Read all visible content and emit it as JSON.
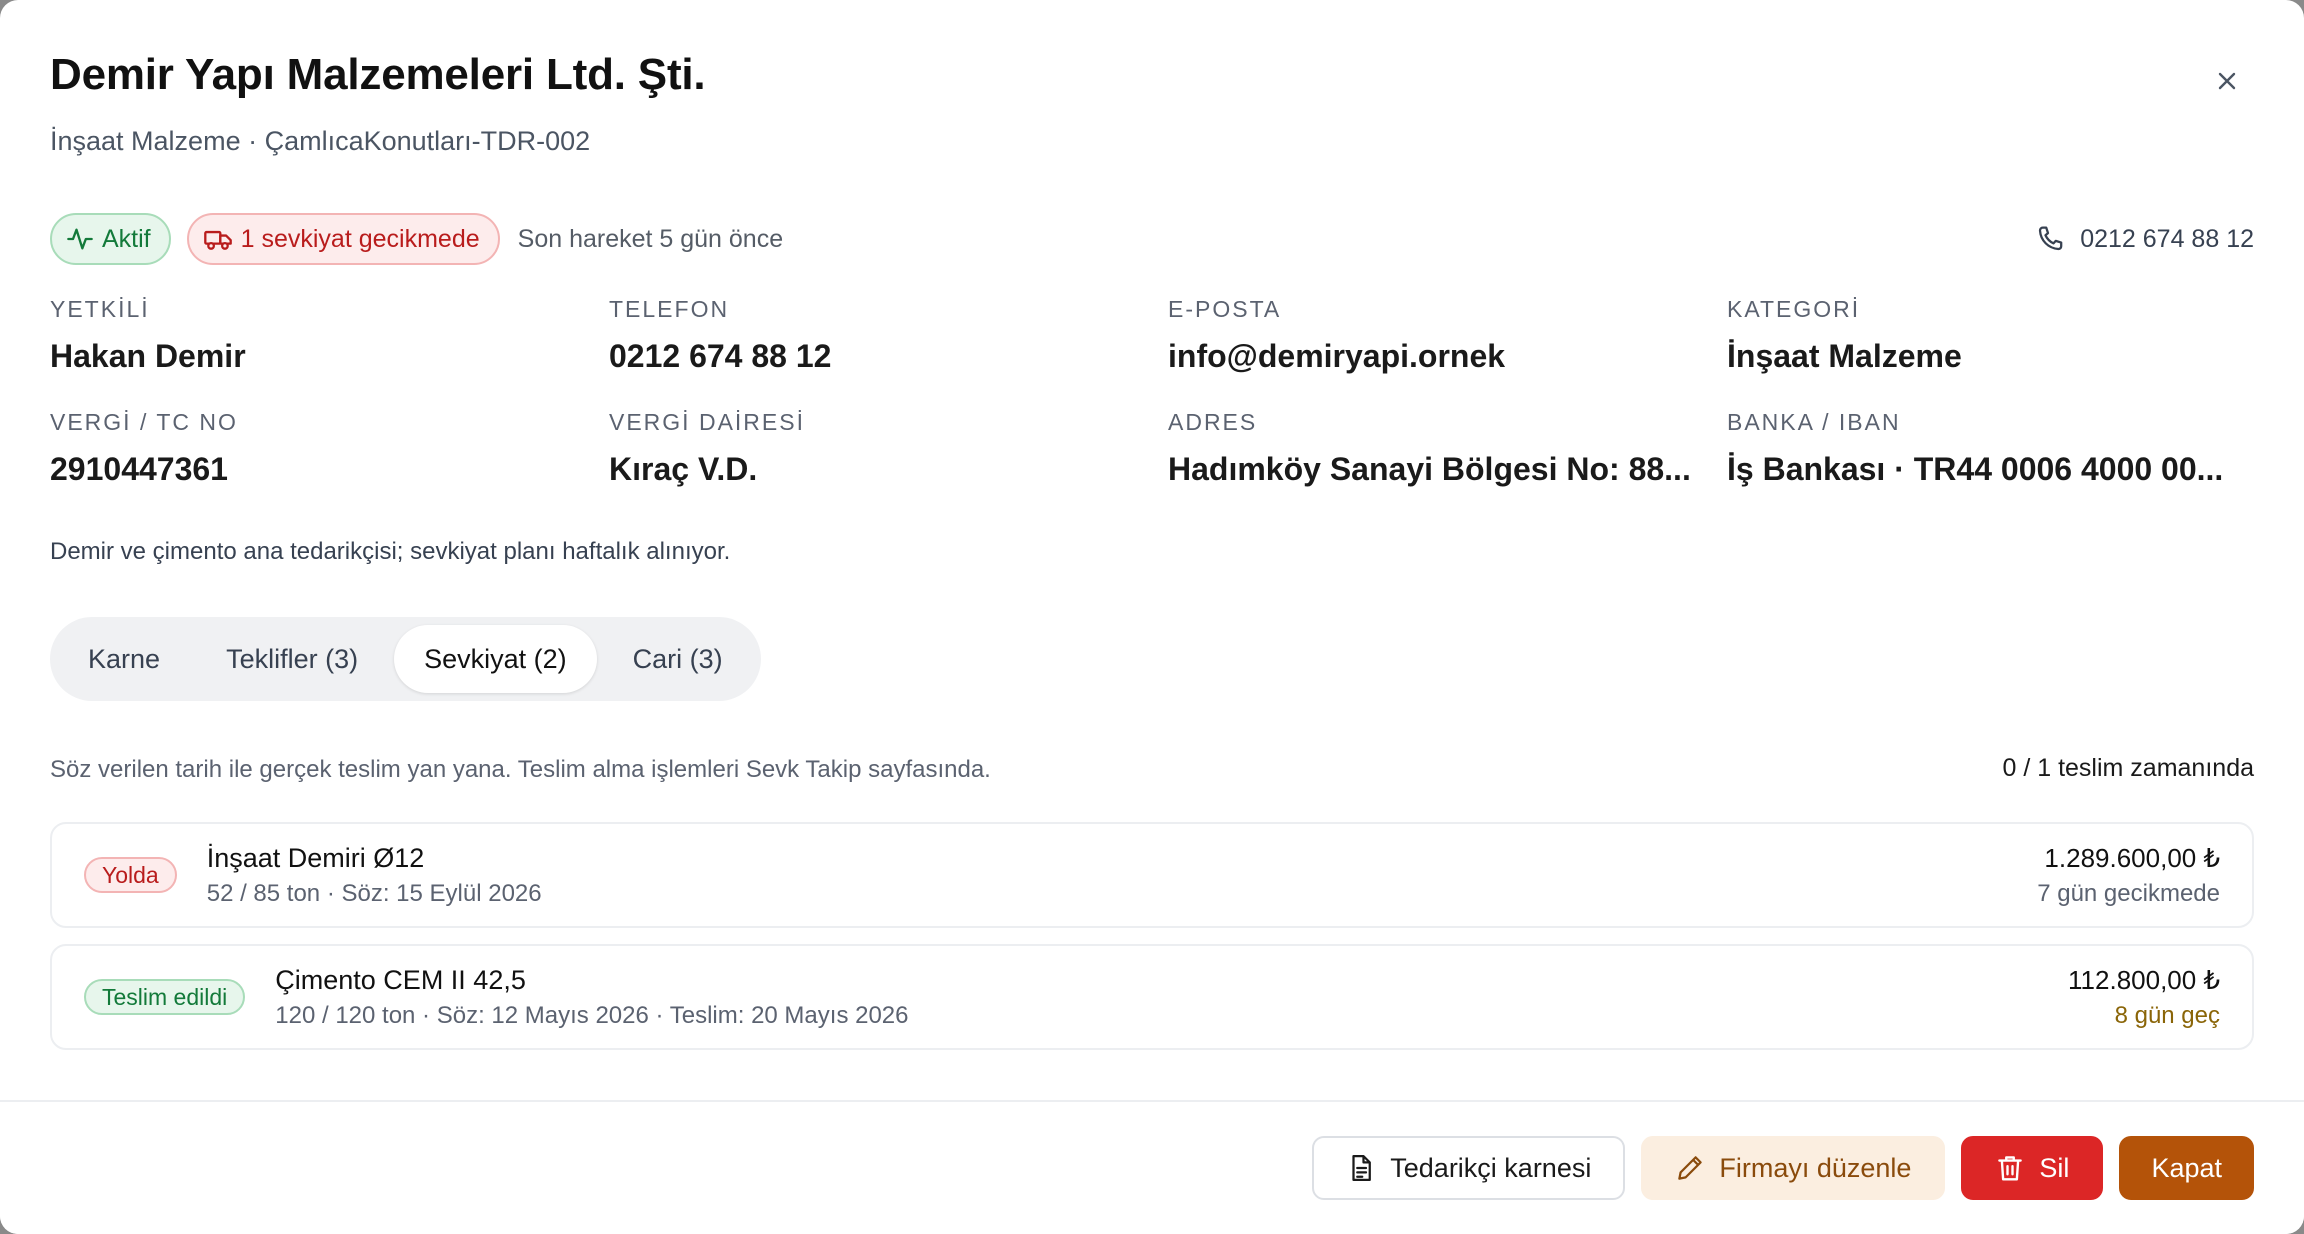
{
  "supplier": {
    "name": "Demir Yapı Malzemeleri Ltd. Şti.",
    "subtitle": "İnşaat Malzeme · ÇamlıcaKonutları-TDR-002"
  },
  "badges": {
    "active": "Aktif",
    "late": "1 sevkiyat gecikmede",
    "last_move": "Son hareket 5 gün önce"
  },
  "contact": {
    "phone": "0212 674 88 12"
  },
  "fields": [
    {
      "label": "YETKİLİ",
      "value": "Hakan Demir"
    },
    {
      "label": "TELEFON",
      "value": "0212 674 88 12"
    },
    {
      "label": "E-POSTA",
      "value": "info@demiryapi.ornek"
    },
    {
      "label": "KATEGORİ",
      "value": "İnşaat Malzeme"
    },
    {
      "label": "VERGİ / TC NO",
      "value": "2910447361"
    },
    {
      "label": "VERGİ DAİRESİ",
      "value": "Kıraç V.D."
    },
    {
      "label": "ADRES",
      "value": "Hadımköy Sanayi Bölgesi No: 88..."
    },
    {
      "label": "BANKA / IBAN",
      "value": "İş Bankası · TR44 0006 4000 00..."
    }
  ],
  "note": "Demir ve çimento ana tedarikçisi; sevkiyat planı haftalık alınıyor.",
  "tabs": [
    {
      "label": "Karne"
    },
    {
      "label": "Teklifler (3)"
    },
    {
      "label": "Sevkiyat (2)",
      "active": true
    },
    {
      "label": "Cari (3)"
    }
  ],
  "shipments": {
    "info": "Söz verilen tarih ile gerçek teslim yan yana. Teslim alma işlemleri Sevk Takip sayfasında.",
    "on_time": "0 / 1 teslim zamanında",
    "rows": [
      {
        "status": "Yolda",
        "name": "İnşaat Demiri Ø12",
        "detail": "52 / 85 ton · Söz: 15 Eylül 2026",
        "amount": "1.289.600,00 ₺",
        "delay": "7 gün gecikmede"
      },
      {
        "status": "Teslim edildi",
        "name": "Çimento CEM II 42,5",
        "detail": "120 / 120 ton · Söz: 12 Mayıs 2026 · Teslim: 20 Mayıs 2026",
        "amount": "112.800,00 ₺",
        "delay": "8 gün geç"
      }
    ]
  },
  "footer": {
    "scorecard": "Tedarikçi karnesi",
    "edit": "Firmayı düzenle",
    "delete": "Sil",
    "close": "Kapat"
  },
  "colors": {
    "primary_amber": "#b45309",
    "danger": "#dc2626",
    "success": "#137a3a"
  }
}
